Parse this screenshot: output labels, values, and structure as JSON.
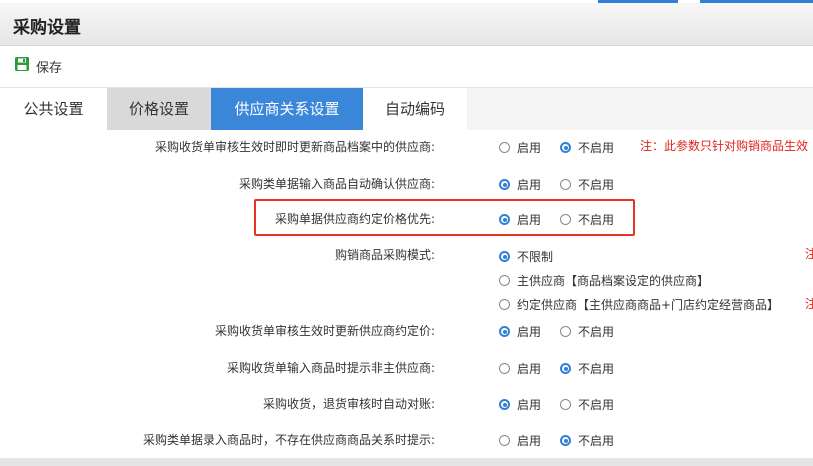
{
  "page": {
    "title": "采购设置"
  },
  "toolbar": {
    "save_label": "保存"
  },
  "tabs": [
    {
      "label": "公共设置"
    },
    {
      "label": "价格设置"
    },
    {
      "label": "供应商关系设置",
      "active": true
    },
    {
      "label": "自动编码"
    }
  ],
  "settings": [
    {
      "label": "采购收货单审核生效时即时更新商品档案中的供应商:",
      "options": [
        "启用",
        "不启用"
      ],
      "selected": "不启用",
      "note": "注：此参数只针对购销商品生效"
    },
    {
      "label": "采购类单据输入商品自动确认供应商:",
      "options": [
        "启用",
        "不启用"
      ],
      "selected": "启用"
    },
    {
      "label": "采购单据供应商约定价格优先:",
      "options": [
        "启用",
        "不启用"
      ],
      "selected": "启用",
      "highlighted": true
    },
    {
      "label": "购销商品采购模式:",
      "options": [
        "不限制",
        "主供应商【商品档案设定的供应商】",
        "约定供应商【主供应商商品+门店约定经营商品】"
      ],
      "selected": "不限制",
      "notes": [
        "注",
        "注"
      ]
    },
    {
      "label": "采购收货单审核生效时更新供应商约定价:",
      "options": [
        "启用",
        "不启用"
      ],
      "selected": "启用"
    },
    {
      "label": "采购收货单输入商品时提示非主供应商:",
      "options": [
        "启用",
        "不启用"
      ],
      "selected": "不启用"
    },
    {
      "label": "采购收货，退货审核时自动对账:",
      "options": [
        "启用",
        "不启用"
      ],
      "selected": "启用"
    },
    {
      "label": "采购类单据录入商品时，不存在供应商商品关系时提示:",
      "options": [
        "启用",
        "不启用"
      ],
      "selected": "不启用"
    }
  ],
  "colors": {
    "accent": "#3a86d8",
    "highlight": "#e63323",
    "note": "#e0241c",
    "save_icon": "#2e9a3c"
  },
  "icons": {
    "save": "floppy-disk-icon"
  }
}
